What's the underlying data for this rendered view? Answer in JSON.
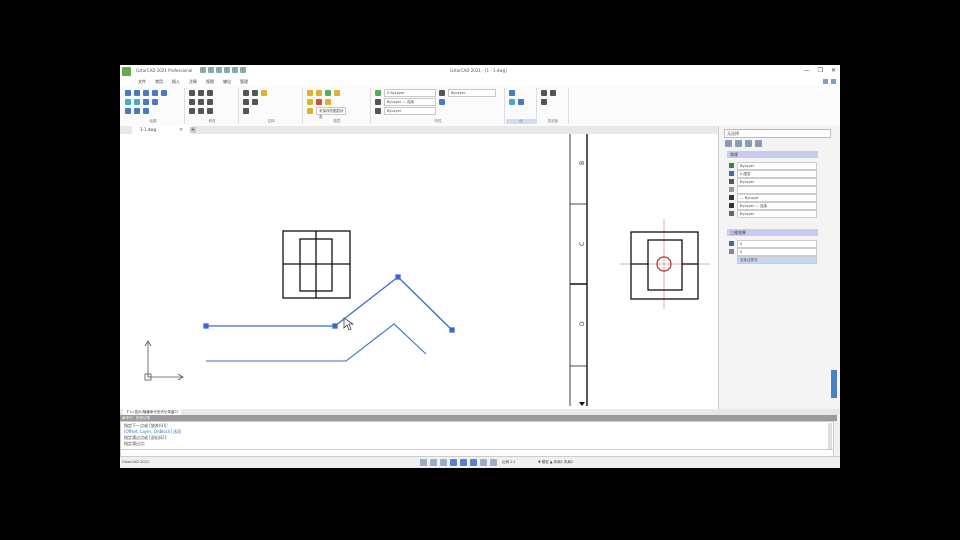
{
  "window": {
    "left_title": "GstarCAD 2021 Professional",
    "center_title": "GstarCAD 2021 - [1 - 1.dwg]",
    "controls": [
      "—",
      "❐",
      "✕"
    ]
  },
  "menu": {
    "items": [
      "文件",
      "常用",
      "插入",
      "注释",
      "视图",
      "输出",
      "管理"
    ]
  },
  "ribbon": {
    "groups": [
      {
        "label": "绘图"
      },
      {
        "label": "修改"
      },
      {
        "label": "注释"
      },
      {
        "label": "图层"
      },
      {
        "label": "特性"
      },
      {
        "label": "块"
      },
      {
        "label": "剪贴板"
      }
    ],
    "dropdowns": {
      "layer_name": "0 ByLayer",
      "color": "ByLayer",
      "linetype": "ByLayer — 连续",
      "lineweight": "ByLayer",
      "layer_state": "未保存的图层状态"
    }
  },
  "tabs": {
    "document": "1-1.dwg",
    "close_icon": "×",
    "add_icon": "+"
  },
  "ruler": {
    "labels": [
      "B",
      "C",
      "D"
    ]
  },
  "right_panel": {
    "search_placeholder": "无选择",
    "general_header": "常规",
    "rows": [
      {
        "label": "ByLayer",
        "color": "#2f8a4a"
      },
      {
        "label": "0-图层",
        "color": "#3a6bc0"
      },
      {
        "label": "ByLayer",
        "color": "#555555"
      },
      {
        "label": "",
        "color": "#999999"
      },
      {
        "label": "— ByLayer",
        "color": "#333333"
      },
      {
        "label": "ByLayer — 连续",
        "color": "#333333"
      },
      {
        "label": "ByLayer",
        "color": "#666666"
      }
    ],
    "view_header": "三维效果",
    "view_rows": [
      {
        "label": "0",
        "color": "#3a6bc0"
      },
      {
        "label": "0",
        "color": "#888888"
      }
    ],
    "selected_row": "无标注样式"
  },
  "command": {
    "tabs": [
      "命令",
      "Ｆ2=显示/隐藏命令历史记录窗口"
    ],
    "header": "命令行 - 历史记录",
    "lines": [
      "指定下一点或 [放弃(U)]:",
      "[Offset, Layer, OnBlock] 选项",
      "指定通过点或 [退出(E)]:",
      "指定通过点:"
    ]
  },
  "status": {
    "left": "GstarCAD 2021",
    "mid": "比例 1:1",
    "right": "▼ 模型 ▲ 布局1 布局2"
  },
  "colors": {
    "blue_lines": "#3a6ad0",
    "crosshair": "#d05050",
    "circle": "#b03030",
    "black_lines": "#111111"
  }
}
